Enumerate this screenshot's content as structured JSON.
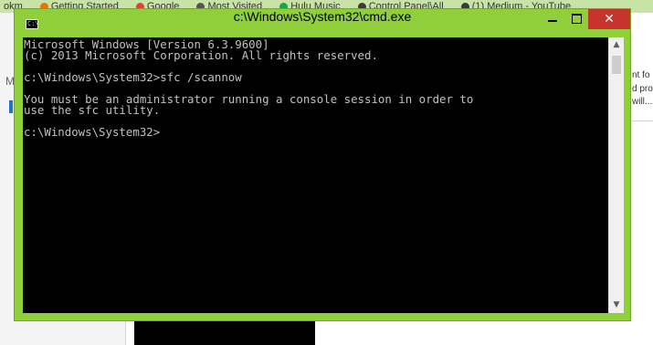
{
  "background": {
    "tabs": [
      {
        "label": "okm",
        "favicon_color": "#7f7f7f"
      },
      {
        "label": "Getting Started",
        "favicon_color": "#e8710a"
      },
      {
        "label": "Google",
        "favicon_color": "#db4437"
      },
      {
        "label": "Most Visited",
        "favicon_color": "#555555"
      },
      {
        "label": "Hulu Music",
        "favicon_color": "#1aa34a"
      },
      {
        "label": "Control Panel\\All",
        "favicon_color": "#3a3a3a"
      },
      {
        "label": "(1) Medium - YouTube",
        "favicon_color": "#3a3a3a"
      }
    ],
    "left_letter": "M",
    "right_text": [
      "nt fo",
      "d pro",
      "will...."
    ]
  },
  "window": {
    "title": "c:\\Windows\\System32\\cmd.exe",
    "icon_label": "C:\\",
    "minimize_glyph": "",
    "maximize_glyph": "",
    "close_glyph": "✕",
    "frame_color": "#8ecf3a",
    "close_color": "#c7342c"
  },
  "console": {
    "lines": [
      "Microsoft Windows [Version 6.3.9600]",
      "(c) 2013 Microsoft Corporation. All rights reserved.",
      "",
      "c:\\Windows\\System32>sfc /scannow",
      "",
      "You must be an administrator running a console session in order to",
      "use the sfc utility.",
      "",
      "c:\\Windows\\System32>"
    ],
    "text_color": "#c0c0c0",
    "background": "#000000"
  },
  "scrollbar": {
    "up_glyph": "▲",
    "down_glyph": "▼"
  }
}
